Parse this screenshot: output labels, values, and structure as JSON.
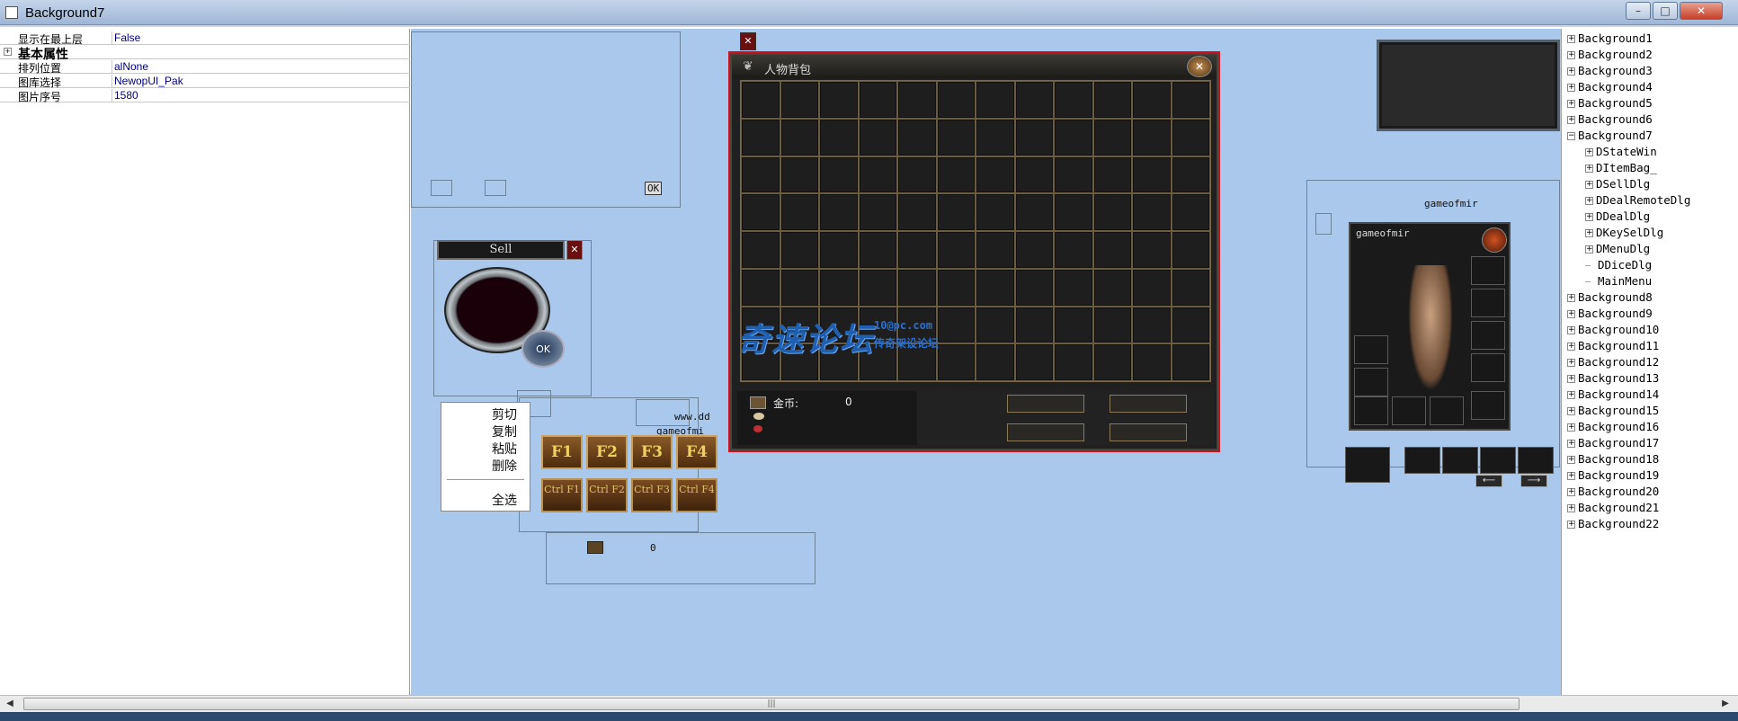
{
  "window": {
    "title": "Background7",
    "min": "–",
    "max": "□",
    "close": "✕"
  },
  "props": {
    "rows": [
      {
        "name": "显示在最上层",
        "value": "False"
      },
      {
        "name": "基本属性",
        "value": ""
      },
      {
        "name": "排列位置",
        "value": "alNone"
      },
      {
        "name": "图库选择",
        "value": "NewopUI_Pak"
      },
      {
        "name": "图片序号",
        "value": "1580"
      }
    ],
    "expand": "+"
  },
  "designer": {
    "ok_label": "OK",
    "sell_title": "Sell",
    "sell_ok": "OK",
    "close_x": "✕",
    "www_text": "www.dd",
    "gameofmir_small": "gameofmi",
    "char_header": "gameofmir",
    "gold_small_value": "0",
    "context_menu": [
      "剪切",
      "复制",
      "粘贴",
      "删除",
      "全选"
    ],
    "fkeys": [
      "F1",
      "F2",
      "F3",
      "F4"
    ],
    "ctrlkeys": [
      "Ctrl F1",
      "Ctrl F2",
      "Ctrl F3",
      "Ctrl F4"
    ],
    "bag": {
      "title": "人物背包",
      "gold_label": "金币:",
      "gold_value": "0"
    },
    "watermark": {
      "main": "奇速论坛",
      "site": "10@pc.com",
      "sub": "传奇架设论坛"
    },
    "charwin": {
      "name": "gameofmir"
    }
  },
  "tree": {
    "items": [
      {
        "label": "Background1",
        "sign": "+",
        "level": 0
      },
      {
        "label": "Background2",
        "sign": "+",
        "level": 0
      },
      {
        "label": "Background3",
        "sign": "+",
        "level": 0
      },
      {
        "label": "Background4",
        "sign": "+",
        "level": 0
      },
      {
        "label": "Background5",
        "sign": "+",
        "level": 0
      },
      {
        "label": "Background6",
        "sign": "+",
        "level": 0
      },
      {
        "label": "Background7",
        "sign": "−",
        "level": 0
      },
      {
        "label": "DStateWin",
        "sign": "+",
        "level": 1
      },
      {
        "label": "DItemBag_",
        "sign": "+",
        "level": 1
      },
      {
        "label": "DSellDlg",
        "sign": "+",
        "level": 1
      },
      {
        "label": "DDealRemoteDlg",
        "sign": "+",
        "level": 1
      },
      {
        "label": "DDealDlg",
        "sign": "+",
        "level": 1
      },
      {
        "label": "DKeySelDlg",
        "sign": "+",
        "level": 1
      },
      {
        "label": "DMenuDlg",
        "sign": "+",
        "level": 1
      },
      {
        "label": "DDiceDlg",
        "sign": "",
        "level": 1
      },
      {
        "label": "MainMenu",
        "sign": "",
        "level": 1
      },
      {
        "label": "Background8",
        "sign": "+",
        "level": 0
      },
      {
        "label": "Background9",
        "sign": "+",
        "level": 0
      },
      {
        "label": "Background10",
        "sign": "+",
        "level": 0
      },
      {
        "label": "Background11",
        "sign": "+",
        "level": 0
      },
      {
        "label": "Background12",
        "sign": "+",
        "level": 0
      },
      {
        "label": "Background13",
        "sign": "+",
        "level": 0
      },
      {
        "label": "Background14",
        "sign": "+",
        "level": 0
      },
      {
        "label": "Background15",
        "sign": "+",
        "level": 0
      },
      {
        "label": "Background16",
        "sign": "+",
        "level": 0
      },
      {
        "label": "Background17",
        "sign": "+",
        "level": 0
      },
      {
        "label": "Background18",
        "sign": "+",
        "level": 0
      },
      {
        "label": "Background19",
        "sign": "+",
        "level": 0
      },
      {
        "label": "Background20",
        "sign": "+",
        "level": 0
      },
      {
        "label": "Background21",
        "sign": "+",
        "level": 0
      },
      {
        "label": "Background22",
        "sign": "+",
        "level": 0
      }
    ]
  },
  "scroll": {
    "left": "◀",
    "right": "▶",
    "grip": "|||"
  },
  "colors": {
    "designer_bg": "#a9c8ec",
    "selection": "#d01020",
    "bag_bg": "#202020"
  }
}
